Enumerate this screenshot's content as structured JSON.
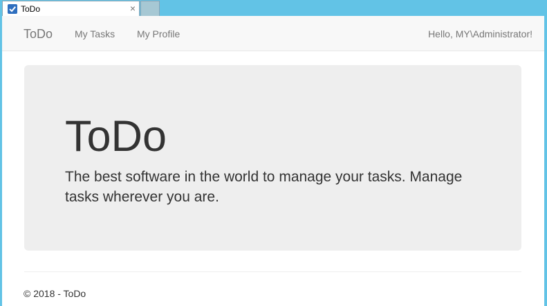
{
  "browser": {
    "tab_title": "ToDo",
    "tab_close": "×",
    "colors": {
      "chrome": "#62c3e6",
      "tab_icon": "#2f6fbf"
    },
    "icons": {
      "tab": "checkbox-icon",
      "close": "close-icon"
    }
  },
  "navbar": {
    "brand": "ToDo",
    "links": [
      "My Tasks",
      "My Profile"
    ],
    "user_greeting": "Hello, MY\\Administrator!"
  },
  "jumbotron": {
    "title": "ToDo",
    "lead": "The best software in the world to manage your tasks. Manage tasks wherever you are."
  },
  "footer": {
    "text": "© 2018 - ToDo"
  }
}
